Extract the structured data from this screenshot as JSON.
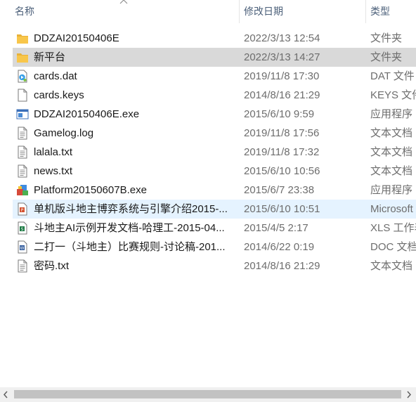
{
  "columns": {
    "name": "名称",
    "date": "修改日期",
    "type": "类型"
  },
  "files": [
    {
      "name": "DDZAI20150406E",
      "date": "2022/3/13 12:54",
      "type": "文件夹",
      "icon": "folder-icon",
      "state": ""
    },
    {
      "name": "新平台",
      "date": "2022/3/13 14:27",
      "type": "文件夹",
      "icon": "folder-icon",
      "state": "selected"
    },
    {
      "name": "cards.dat",
      "date": "2019/11/8 17:30",
      "type": "DAT 文件",
      "icon": "media-file-icon",
      "state": ""
    },
    {
      "name": "cards.keys",
      "date": "2014/8/16 21:29",
      "type": "KEYS 文件",
      "icon": "blank-file-icon",
      "state": ""
    },
    {
      "name": "DDZAI20150406E.exe",
      "date": "2015/6/10 9:59",
      "type": "应用程序",
      "icon": "application-icon",
      "state": ""
    },
    {
      "name": "Gamelog.log",
      "date": "2019/11/8 17:56",
      "type": "文本文档",
      "icon": "text-file-icon",
      "state": ""
    },
    {
      "name": "lalala.txt",
      "date": "2019/11/8 17:32",
      "type": "文本文档",
      "icon": "text-file-icon",
      "state": ""
    },
    {
      "name": "news.txt",
      "date": "2015/6/10 10:56",
      "type": "文本文档",
      "icon": "text-file-icon",
      "state": ""
    },
    {
      "name": "Platform20150607B.exe",
      "date": "2015/6/7 23:38",
      "type": "应用程序",
      "icon": "installer-icon",
      "state": ""
    },
    {
      "name": "单机版斗地主博弈系统与引擎介绍2015-...",
      "date": "2015/6/10 10:51",
      "type": "Microsoft",
      "icon": "powerpoint-file-icon",
      "state": "hover"
    },
    {
      "name": "斗地主AI示例开发文档-哈理工-2015-04...",
      "date": "2015/4/5 2:17",
      "type": "XLS 工作表",
      "icon": "excel-file-icon",
      "state": ""
    },
    {
      "name": "二打一（斗地主）比赛规则-讨论稿-201...",
      "date": "2014/6/22 0:19",
      "type": "DOC 文档",
      "icon": "word-file-icon",
      "state": ""
    },
    {
      "name": "密码.txt",
      "date": "2014/8/16 21:29",
      "type": "文本文档",
      "icon": "text-file-icon",
      "state": ""
    }
  ],
  "colors": {
    "selected_row": "#d9d9d9",
    "hover_row": "#e5f3ff",
    "header_text": "#4c607a",
    "meta_text": "#6d6d6d",
    "folder": "#f8c64a"
  }
}
